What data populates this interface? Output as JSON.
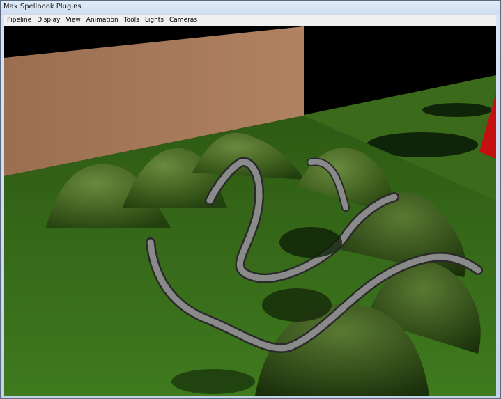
{
  "window": {
    "title": "Max Spellbook Plugins"
  },
  "menu": {
    "items": [
      {
        "label": "Pipeline"
      },
      {
        "label": "Display"
      },
      {
        "label": "View"
      },
      {
        "label": "Animation"
      },
      {
        "label": "Tools"
      },
      {
        "label": "Lights"
      },
      {
        "label": "Cameras"
      }
    ]
  },
  "scene": {
    "colors": {
      "background": "#000000",
      "grass": "#3d6b1e",
      "grass_dark": "#22400e",
      "wall": "#a87a5a",
      "path_stone": "#8a8a8a",
      "red_object": "#c41010"
    }
  }
}
